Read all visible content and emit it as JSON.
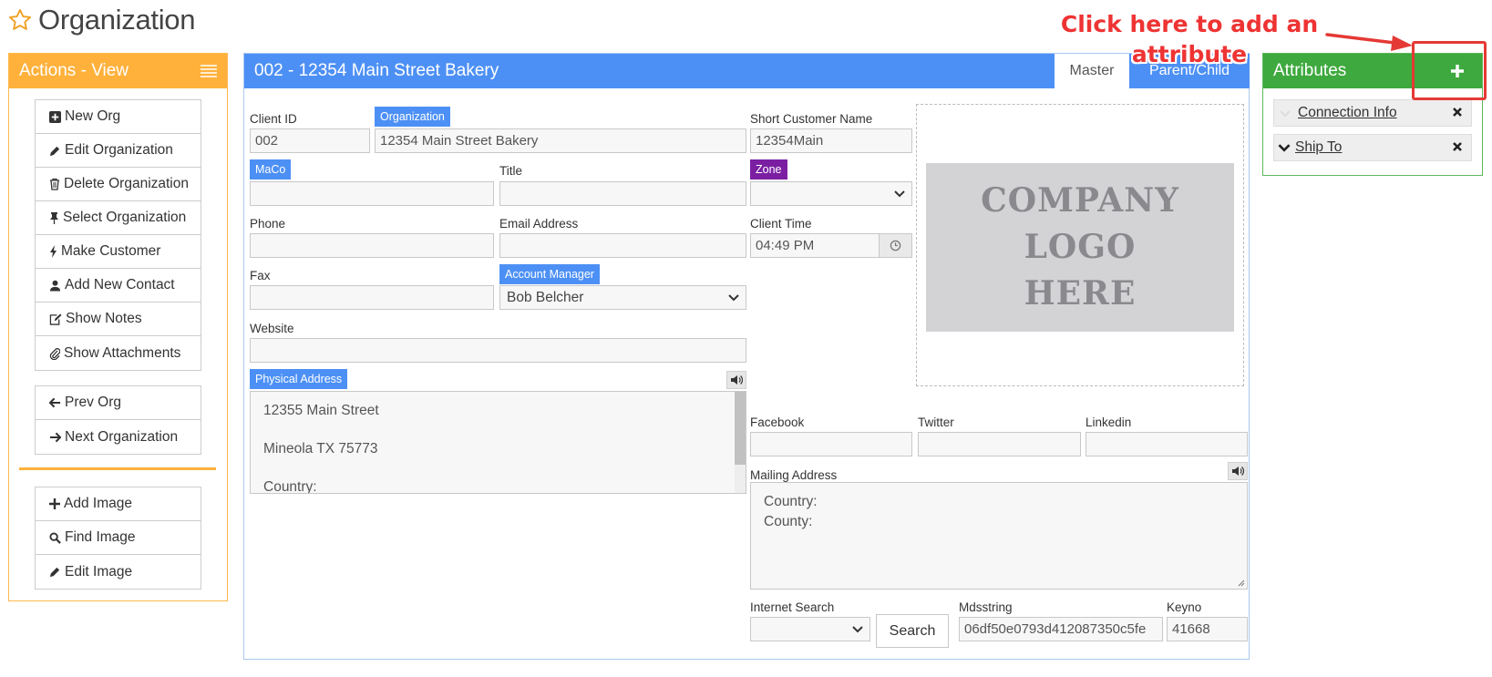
{
  "page": {
    "title": "Organization"
  },
  "actions": {
    "title": "Actions - View",
    "group1": [
      "New Org",
      "Edit Organization",
      "Delete Organization",
      "Select Organization",
      "Make Customer",
      "Add New Contact",
      "Show Notes",
      "Show Attachments"
    ],
    "group2": [
      "Prev Org",
      "Next Organization"
    ],
    "group3": [
      "Add Image",
      "Find Image",
      "Edit Image"
    ]
  },
  "main": {
    "title": "002 - 12354 Main Street Bakery",
    "tabs": [
      "Master",
      "Parent/Child"
    ],
    "fields": {
      "client_id": {
        "label": "Client ID",
        "value": "002"
      },
      "organization": {
        "label": "Organization",
        "value": "12354 Main Street Bakery"
      },
      "short_name": {
        "label": "Short Customer Name",
        "value": "12354Main"
      },
      "maco": {
        "label": "MaCo",
        "value": ""
      },
      "title": {
        "label": "Title",
        "value": ""
      },
      "zone": {
        "label": "Zone",
        "value": ""
      },
      "phone": {
        "label": "Phone",
        "value": ""
      },
      "email": {
        "label": "Email Address",
        "value": ""
      },
      "client_time": {
        "label": "Client Time",
        "value": "04:49 PM"
      },
      "fax": {
        "label": "Fax",
        "value": ""
      },
      "account_manager": {
        "label": "Account Manager",
        "value": "Bob Belcher"
      },
      "website": {
        "label": "Website",
        "value": ""
      },
      "physical_address": {
        "label": "Physical Address",
        "line1": "12355 Main Street",
        "line2": "Mineola TX  75773",
        "line3": "Country:"
      },
      "facebook": {
        "label": "Facebook",
        "value": ""
      },
      "twitter": {
        "label": "Twitter",
        "value": ""
      },
      "linkedin": {
        "label": "Linkedin",
        "value": ""
      },
      "mailing_address": {
        "label": "Mailing Address",
        "line1": "Country:",
        "line2": "County:"
      },
      "internet_search": {
        "label": "Internet Search",
        "value": "",
        "button": "Search"
      },
      "mdsstring": {
        "label": "Mdsstring",
        "value": "06df50e0793d412087350c5fe"
      },
      "keyno": {
        "label": "Keyno",
        "value": "41668"
      }
    },
    "logo": {
      "line1": "COMPANY",
      "line2": "LOGO",
      "line3": "HERE"
    }
  },
  "attributes": {
    "title": "Attributes",
    "items": [
      "Connection Info",
      "Ship To"
    ]
  },
  "annotation": {
    "text": "Click here to add an attribute"
  },
  "colors": {
    "orange": "#ffb13b",
    "blue": "#4d90f5",
    "purple": "#7b1fa2",
    "green": "#3ea93e",
    "annotation_red": "#e53935"
  }
}
